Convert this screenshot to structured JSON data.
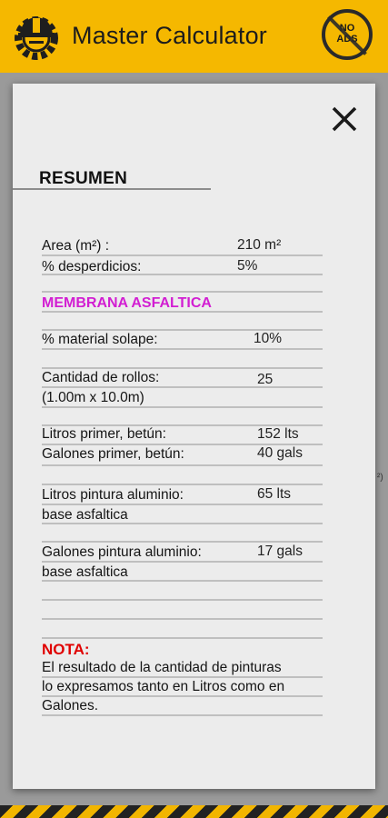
{
  "app": {
    "title": "Master Calculator",
    "no_ads_line1": "NO",
    "no_ads_line2": "ADS"
  },
  "dialog": {
    "heading": "RESUMEN",
    "area_label": "Area (m²) :",
    "area_value": "210 m²",
    "waste_label": "% desperdicios:",
    "waste_value": "5%",
    "section_title": "MEMBRANA ASFALTICA",
    "overlap_label": "% material solape:",
    "overlap_value": "10%",
    "rolls_label_1": "Cantidad de rollos:",
    "rolls_label_2": "(1.00m x 10.0m)",
    "rolls_value": "25",
    "primer_liters_label": "Litros primer, betún:",
    "primer_liters_value": "152 lts",
    "primer_gallons_label": "Galones primer, betún:",
    "primer_gallons_value": "40 gals",
    "paint_liters_label_1": "Litros pintura aluminio:",
    "paint_liters_label_2": "base asfaltica",
    "paint_liters_value": "65 lts",
    "paint_gallons_label_1": "Galones pintura aluminio:",
    "paint_gallons_label_2": "base asfaltica",
    "paint_gallons_value": "17 gals",
    "note_title": "NOTA:",
    "note_line_1": "El resultado de la cantidad de pinturas",
    "note_line_2": "lo expresamos tanto en Litros como en",
    "note_line_3": "Galones."
  },
  "background": {
    "side_glyph": "²)"
  },
  "colors": {
    "appbar": "#f5b800",
    "section_title": "#d21ed2",
    "note_title": "#e00000"
  },
  "icons": {
    "logo": "gear-hardhat-icon",
    "close": "close-icon",
    "no_ads": "no-ads-badge-icon"
  }
}
